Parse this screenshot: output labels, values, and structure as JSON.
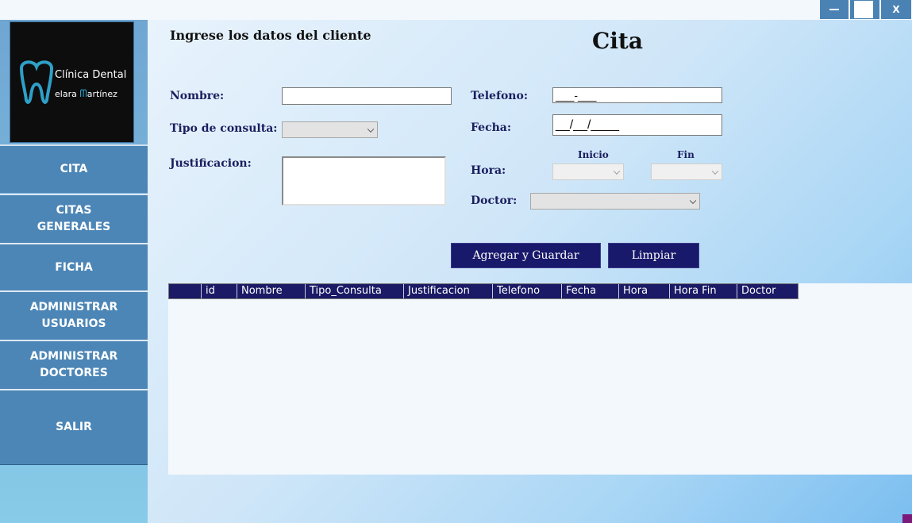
{
  "window": {
    "minimize_label": "—",
    "close_label": "X"
  },
  "logo": {
    "line1": "Clínica Dental",
    "line2": "elara ",
    "line3": "artínez"
  },
  "nav": {
    "cita": "CITA",
    "citas_generales": "CITAS\nGENERALES",
    "ficha": "FICHA",
    "administrar_usuarios": "ADMINISTRAR\nUSUARIOS",
    "administrar_doctores": "ADMINISTRAR\nDOCTORES",
    "salir": "SALIR"
  },
  "form": {
    "heading": "Ingrese los datos del cliente",
    "title": "Cita",
    "nombre_label": "Nombre:",
    "nombre_value": "",
    "tipo_label": "Tipo de consulta:",
    "tipo_value": "",
    "justificacion_label": "Justificacion:",
    "justificacion_value": "",
    "telefono_label": "Telefono:",
    "telefono_value": "___-___",
    "fecha_label": "Fecha:",
    "fecha_value": "__/__/____",
    "hora_label": "Hora:",
    "inicio_label": "Inicio",
    "fin_label": "Fin",
    "doctor_label": "Doctor:"
  },
  "buttons": {
    "agregar": "Agregar y Guardar",
    "limpiar": "Limpiar"
  },
  "table": {
    "columns": [
      "",
      "id",
      "Nombre",
      "Tipo_Consulta",
      "Justificacion",
      "Telefono",
      "Fecha",
      "Hora",
      "Hora Fin",
      "Doctor"
    ],
    "rows": []
  },
  "colors": {
    "nav": "#4c86b6",
    "header": "#1a1a66",
    "button": "#19196b",
    "label": "#1b1e5f"
  }
}
